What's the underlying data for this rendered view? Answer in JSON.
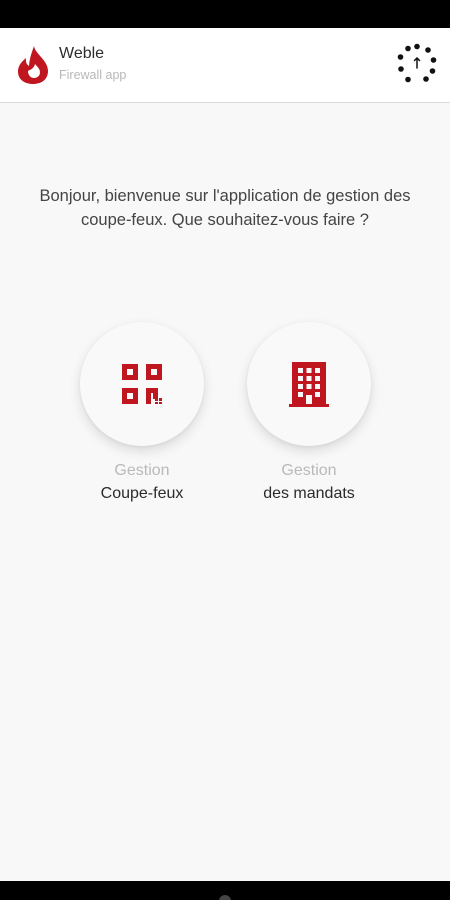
{
  "header": {
    "app_name": "Weble",
    "app_subtitle": "Firewall app",
    "logo_icon": "flame-logo-icon",
    "scan_icon": "qr-scan-icon"
  },
  "welcome": {
    "message": "Bonjour, bienvenue sur l'application de gestion des coupe-feux. Que souhaitez-vous faire ?"
  },
  "actions": [
    {
      "line1": "Gestion",
      "line2": "Coupe-feux",
      "icon": "qr-code-icon"
    },
    {
      "line1": "Gestion",
      "line2": "des mandats",
      "icon": "building-icon"
    }
  ],
  "colors": {
    "accent": "#c0161f",
    "background": "#f8f8f8",
    "header_background": "#ffffff"
  }
}
